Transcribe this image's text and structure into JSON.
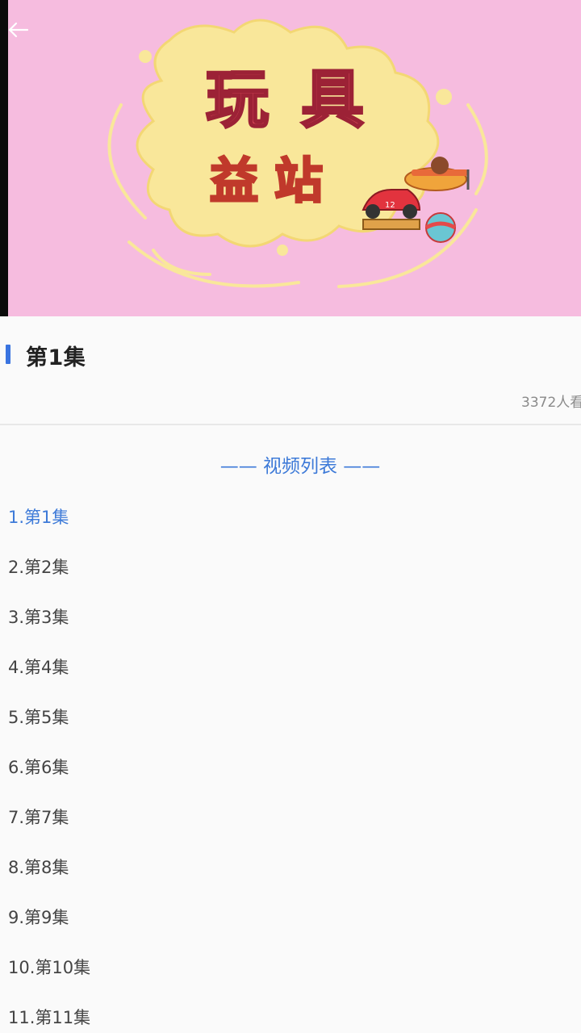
{
  "player": {
    "back_icon": "back-arrow-icon",
    "poster_text_line1": "玩具",
    "poster_text_line2": "益站",
    "car_number": "12"
  },
  "episode": {
    "title": "第1集",
    "views": "3372人看"
  },
  "list": {
    "header": "—— 视频列表 ——",
    "items": [
      {
        "label": "1.第1集",
        "active": true
      },
      {
        "label": "2.第2集",
        "active": false
      },
      {
        "label": "3.第3集",
        "active": false
      },
      {
        "label": "4.第4集",
        "active": false
      },
      {
        "label": "5.第5集",
        "active": false
      },
      {
        "label": "6.第6集",
        "active": false
      },
      {
        "label": "7.第7集",
        "active": false
      },
      {
        "label": "8.第8集",
        "active": false
      },
      {
        "label": "9.第9集",
        "active": false
      },
      {
        "label": "10.第10集",
        "active": false
      },
      {
        "label": "11.第11集",
        "active": false
      }
    ]
  },
  "colors": {
    "accent": "#3d7ad8",
    "poster_bg": "#f6bcdf",
    "splash": "#f9e79a"
  }
}
